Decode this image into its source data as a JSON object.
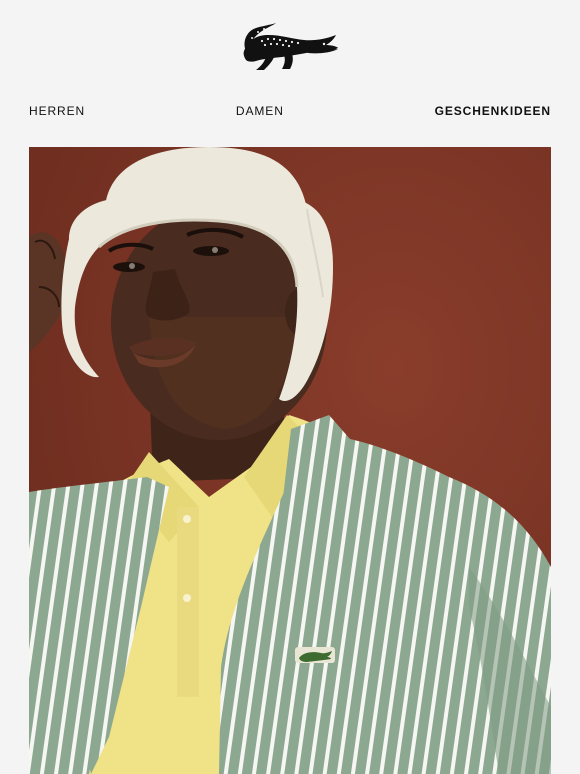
{
  "brand": {
    "logo_icon": "crocodile-icon",
    "logo_color": "#111111"
  },
  "nav": {
    "items": [
      {
        "label": "HERREN",
        "weight": "normal"
      },
      {
        "label": "DAMEN",
        "weight": "normal"
      },
      {
        "label": "GESCHENKIDEEN",
        "weight": "bold"
      }
    ]
  },
  "hero": {
    "image_icon": "hero-photo",
    "colors": {
      "background": "#7d3525",
      "hat": "#ece8dc",
      "shirt_base": "#8da890",
      "stripe": "#f6f6f2",
      "polo": "#f0e287",
      "skin": "#4a2b1f"
    },
    "badge_icon": "crocodile-badge-icon"
  }
}
